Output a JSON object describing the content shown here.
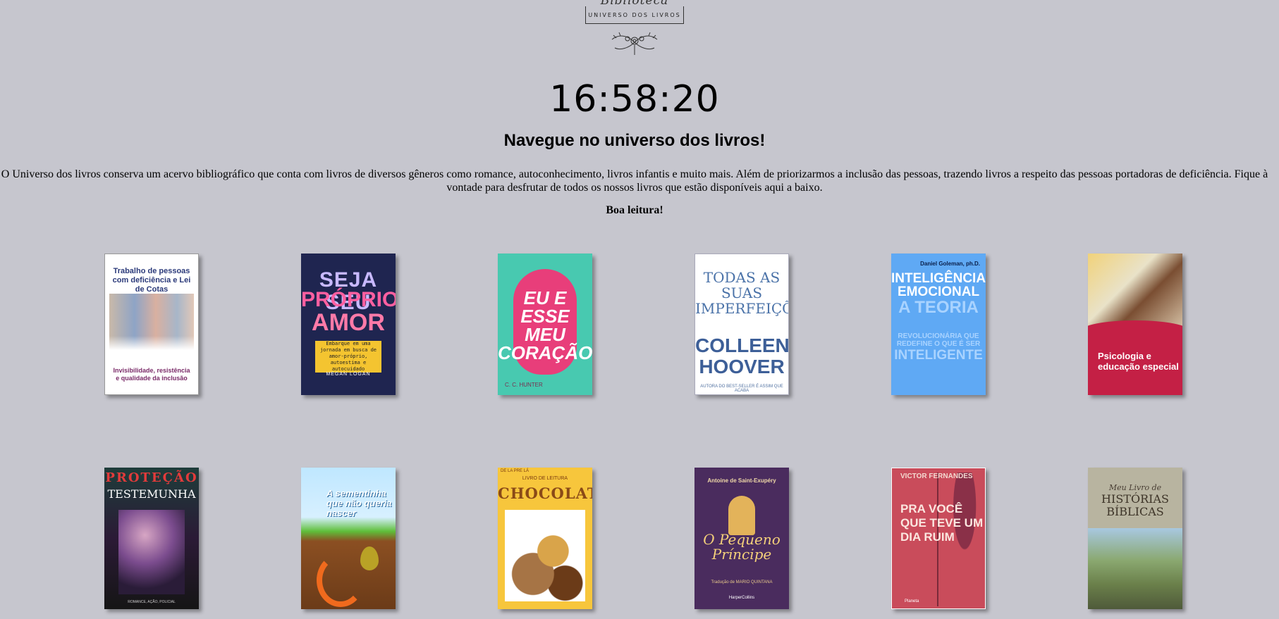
{
  "logo": {
    "script_text": "Biblioteca",
    "subtitle": "UNIVERSO DOS LIVROS"
  },
  "clock": {
    "time": "16:58:20"
  },
  "headline": "Navegue no universo dos livros!",
  "intro": {
    "line1": "O Universo dos livros conserva um acervo bibliográfico que conta com livros de diversos gêneros como romance, autoconhecimento, livros infantis e muito mais. Além de priorizarmos a inclusão das pessoas, trazendo livros a respeito das pessoas portadoras de deficiência. Fique à",
    "line2": "vontade para desfrutar de todos os nossos livros que estão disponíveis aqui a baixo."
  },
  "closing": "Boa leitura!",
  "books": [
    {
      "title": "Trabalho de pessoas com deficiência e Lei de Cotas",
      "subtitle": "Invisibilidade, resistência e qualidade da inclusão"
    },
    {
      "title_a": "SEJA SEU",
      "title_b": "PRÓPRIO",
      "title_c": "AMOR",
      "tagline": "Embarque em uma jornada em busca de amor-próprio, autoestima e autocuidado",
      "author": "MEGAN LOGAN"
    },
    {
      "title": "EU E ESSE MEU CORAÇÃO",
      "author": "C. C. HUNTER"
    },
    {
      "title": "TODAS AS SUAS IMPERFEIÇÕES",
      "author": "COLLEEN HOOVER",
      "note": "AUTORA DO BEST-SELLER É ASSIM QUE ACABA"
    },
    {
      "author": "Daniel Goleman, ph.D.",
      "title_a": "INTELIGÊNCIA EMOCIONAL",
      "title_b": "A TEORIA",
      "title_c": "REVOLUCIONÁRIA QUE REDEFINE O QUE É SER",
      "title_d": "INTELIGENTE"
    },
    {
      "title": "Psicologia e educação especial"
    },
    {
      "title_a": "PROTEÇÃO",
      "title_b": "TESTEMUNHA",
      "note": "ROMANCE, AÇÃO, POLICIAL"
    },
    {
      "title": "A sementinha que não queria nascer"
    },
    {
      "series": "DE LA PRE LÁ",
      "label": "LIVRO DE LEITURA",
      "title": "CHOCOLATE"
    },
    {
      "author": "Antoine de Saint-Exupéry",
      "title": "O Pequeno Príncipe",
      "translator": "Tradução de MARIO QUINTANA",
      "publisher": "HarperCollins"
    },
    {
      "author": "VICTOR FERNANDES",
      "title": "PRA VOCÊ QUE TEVE UM DIA RUIM",
      "publisher": "Planeta"
    },
    {
      "title_a": "Meu Livro de",
      "title_b": "HISTÓRIAS BÍBLICAS"
    }
  ],
  "colors": {
    "background": "#c6c6ce",
    "text": "#000000"
  }
}
